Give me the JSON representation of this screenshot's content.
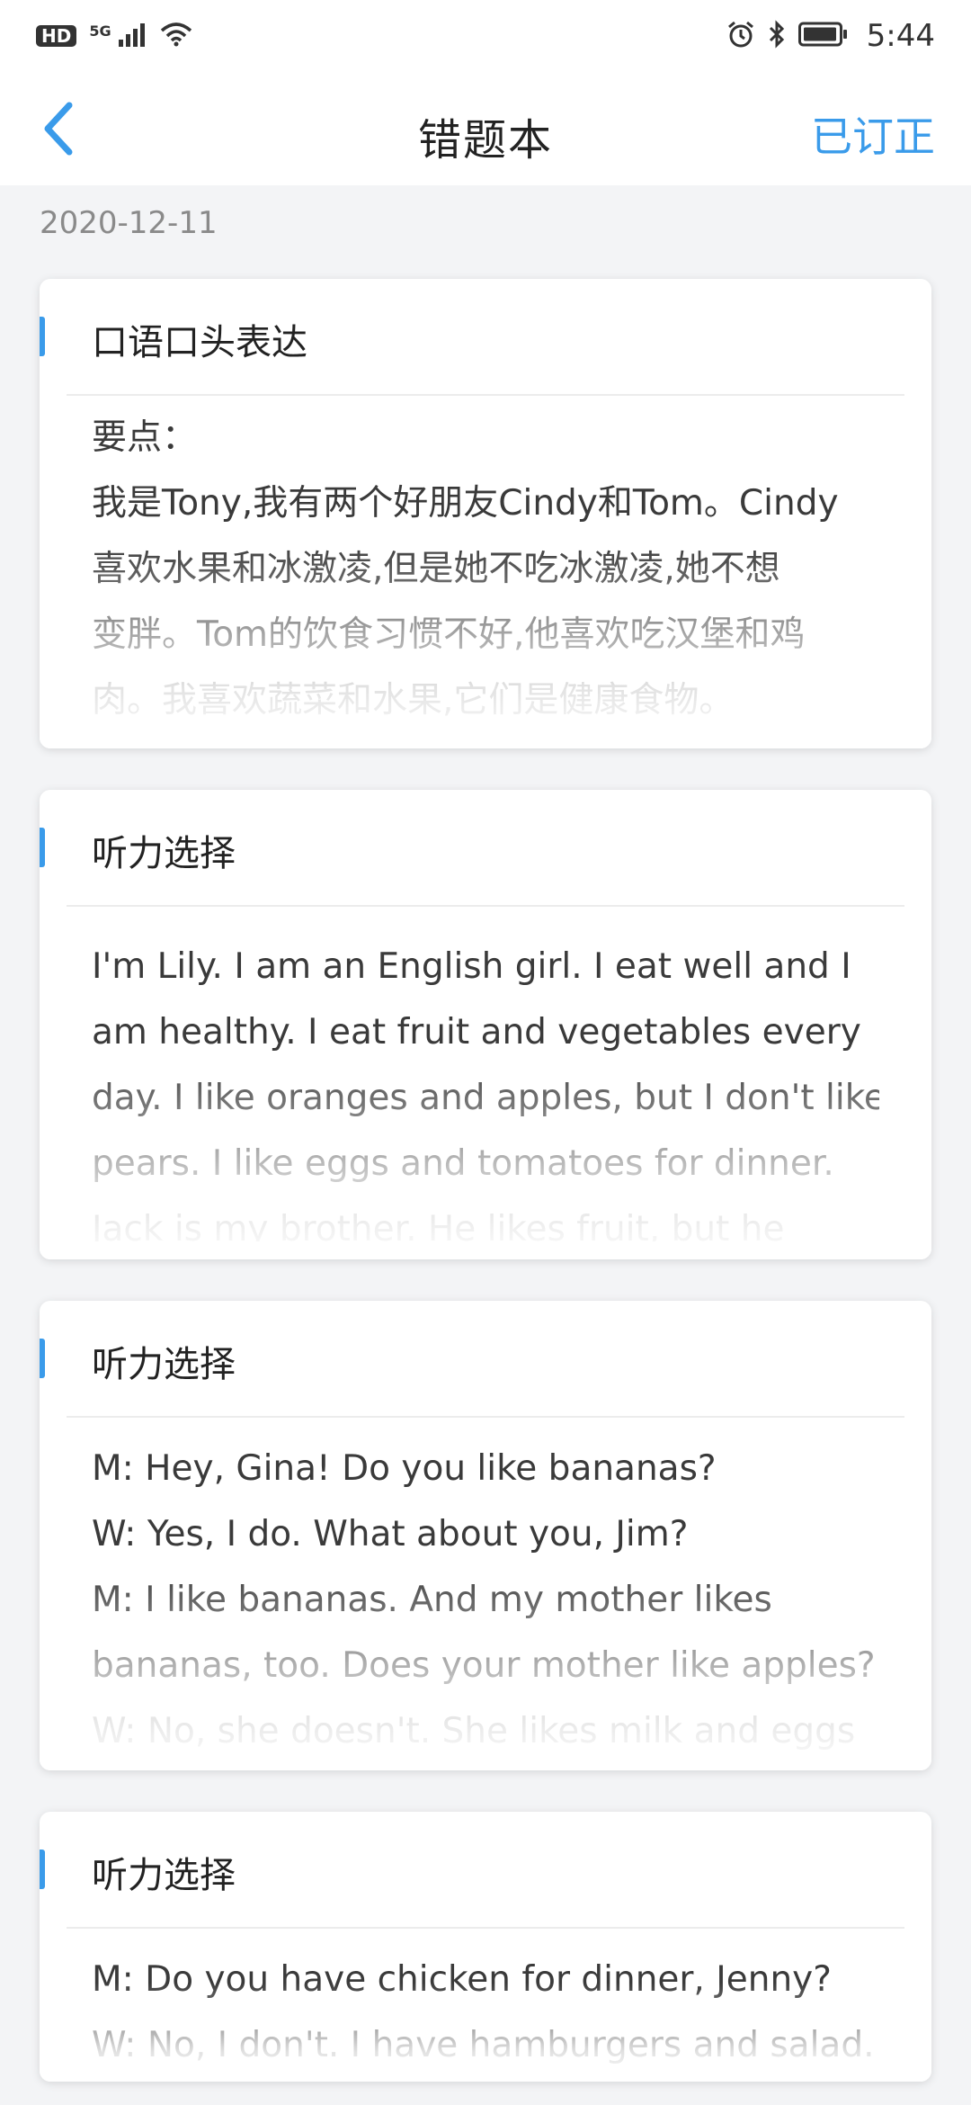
{
  "status_bar": {
    "hd": "HD",
    "network": "5G",
    "time": "5:44"
  },
  "header": {
    "title": "错题本",
    "action_label": "已订正",
    "accent_color": "#3a9bea"
  },
  "date": "2020-12-11",
  "cards": [
    {
      "title": "口语口头表达",
      "lines": [
        "要点：",
        "我是Tony,我有两个好朋友Cindy和Tom。Cindy",
        "喜欢水果和冰激凌,但是她不吃冰激凌,她不想",
        "变胖。Tom的饮食习惯不好,他喜欢吃汉堡和鸡",
        "肉。我喜欢蔬菜和水果,它们是健康食物。"
      ]
    },
    {
      "title": "听力选择",
      "lines": [
        "I'm Lily. I am an English girl. I eat well and I",
        "am healthy. I eat fruit and vegetables every",
        "day. I like oranges and apples, but I don't like",
        "pears. I like eggs and tomatoes for dinner.",
        "Jack is my brother. He likes fruit, but he"
      ]
    },
    {
      "title": "听力选择",
      "lines": [
        "M: Hey, Gina! Do you like bananas?",
        "W: Yes, I do. What about you, Jim?",
        "M: I like bananas. And my mother likes",
        "bananas, too. Does your mother like apples?",
        "W: No, she doesn't. She likes milk and eggs"
      ]
    },
    {
      "title": "听力选择",
      "lines": [
        "M: Do you have chicken for dinner, Jenny?",
        "W: No, I don't. I have hamburgers and salad."
      ]
    }
  ]
}
